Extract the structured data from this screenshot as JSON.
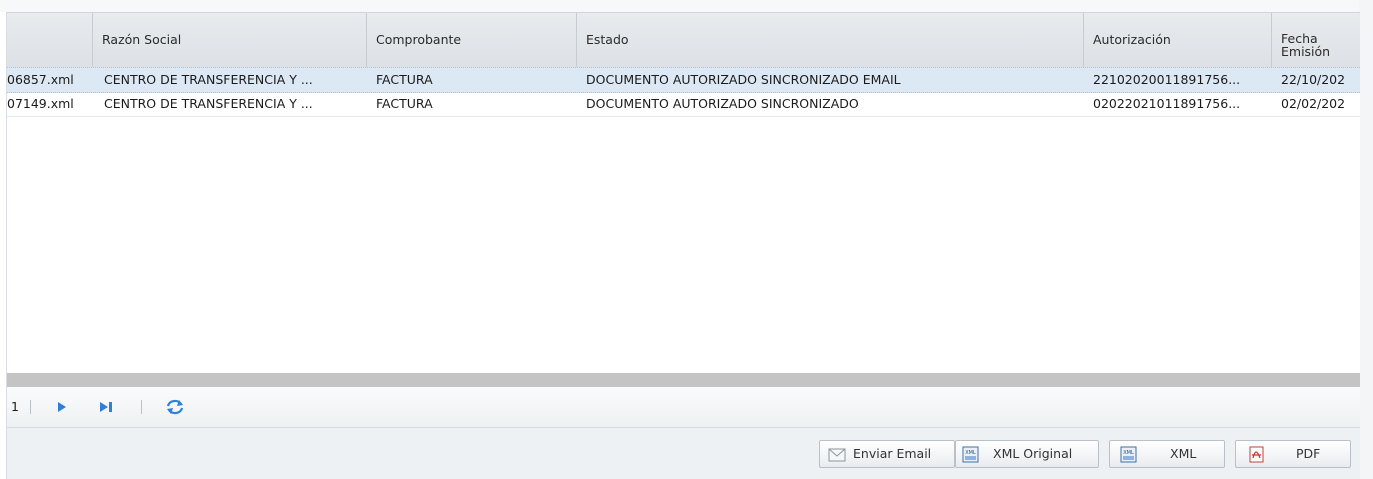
{
  "columns": [
    "",
    "Razón Social",
    "Comprobante",
    "Estado",
    "Autorización",
    "Fecha",
    "Emisión"
  ],
  "rows": [
    {
      "archivo": "06857.xml",
      "razon_social": "CENTRO DE TRANSFERENCIA Y ...",
      "comprobante": "FACTURA",
      "estado": "DOCUMENTO AUTORIZADO SINCRONIZADO EMAIL",
      "autorizacion": "22102020011891756...",
      "fecha": "22/10/202",
      "selected": true
    },
    {
      "archivo": "07149.xml",
      "razon_social": "CENTRO DE TRANSFERENCIA Y ...",
      "comprobante": "FACTURA",
      "estado": "DOCUMENTO AUTORIZADO SINCRONIZADO",
      "autorizacion": "02022021011891756...",
      "fecha": "02/02/202",
      "selected": false
    }
  ],
  "pager": {
    "page_total": "1"
  },
  "buttons": {
    "enviar_email": "Enviar Email",
    "xml_original": "XML Original",
    "xml": "XML",
    "pdf": "PDF"
  },
  "icons": [
    "envelope-icon",
    "xml-file-icon",
    "xml-file-icon",
    "pdf-file-icon",
    "next-page-icon",
    "last-page-icon",
    "refresh-icon"
  ],
  "colors": {
    "selected_row": "#dde8f5",
    "header": "#e2e6ea",
    "pager_icon": "#2f7fd6"
  }
}
